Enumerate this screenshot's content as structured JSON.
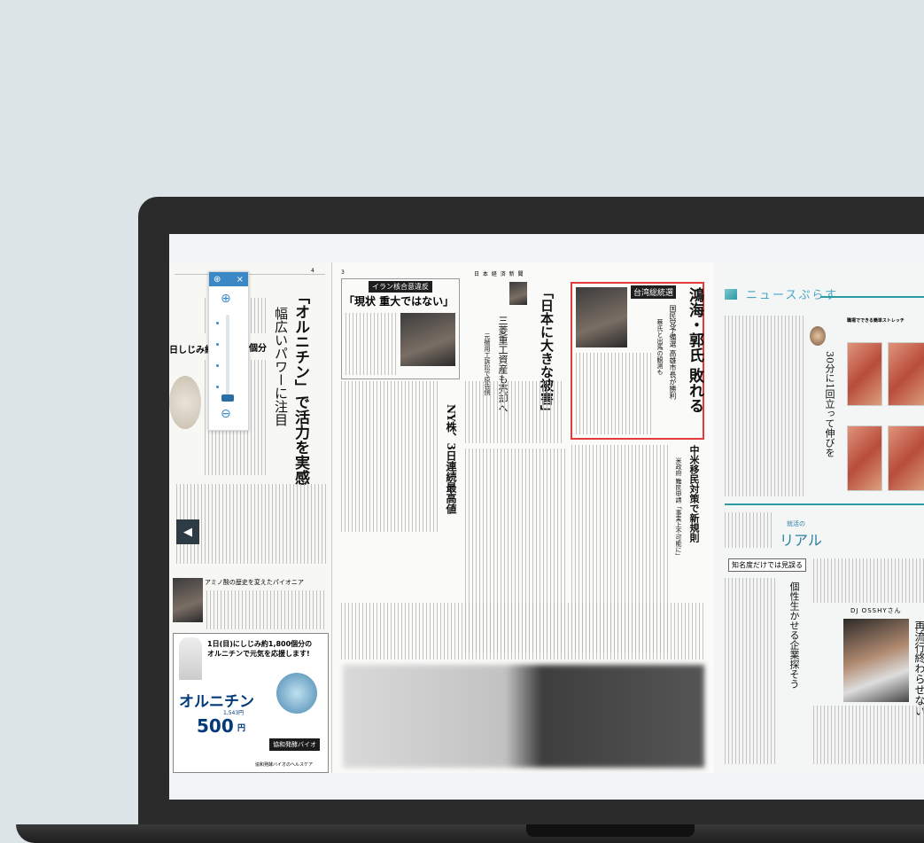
{
  "zoom_panel": {
    "zoom_in": "⊕",
    "close": "×",
    "zoom_out": "⊖",
    "level": 0.1
  },
  "left_page": {
    "page_no": "4",
    "headline_1": "「オルニチン」で活力を実感",
    "headline_2": "幅広いパワーに注目",
    "strip_text": "日しじみ約",
    "strip_text_2": "個分",
    "section_title": "アミノ酸の歴史を変えたパイオニア",
    "ad_line_1": "1日(目)にしじみ約1,800個分の",
    "ad_line_2": "オルニチンで元気を応援します!",
    "ad_brand": "オルニチン",
    "ad_price_label": "1,543円",
    "ad_price": "500",
    "ad_price_unit": "円",
    "ad_company": "協和発酵バイオ",
    "ad_footer": "協和発酵バイオのヘルスケア"
  },
  "center_page": {
    "page_no": "3",
    "top_header": "日 本 経 済 新 聞",
    "box_label": "イラン核合意違反",
    "box_headline": "「現状 重大ではない」",
    "headline_damage": "「日本に大きな被害」",
    "headline_mitsubishi": "三菱重工資産も売却へ",
    "sub_mitsubishi": "元徴用工訴訟で原告側",
    "headline_ny": "NY株、3日連続最高値",
    "taiwan_label": "台湾総統選",
    "taiwan_headline": "鴻海・郭氏 敗れる",
    "taiwan_sub_1": "国民党予備選 高雄市長が勝利",
    "taiwan_sub_2": "蔡氏と出馬の観測も",
    "headline_immigration": "中米移民対策で新規則",
    "sub_immigration": "米政府 難民申請「事実上不可能に」"
  },
  "right_page": {
    "header": "ニュースぷらす",
    "stretch_title": "職場でできる簡単ストレッチ",
    "stretch_headline": "30分に1回立って伸びを",
    "shukatsu_label": "就活の",
    "shukatsu_title": "リアル",
    "chimei_label": "知名度だけでは見誤る",
    "kosei_headline": "個性生かせる企業探そう",
    "dj_label": "DJ OSSHYさん",
    "dj_headline": "再流行終わらせない"
  },
  "nav": {
    "prev_arrow": "◀"
  }
}
